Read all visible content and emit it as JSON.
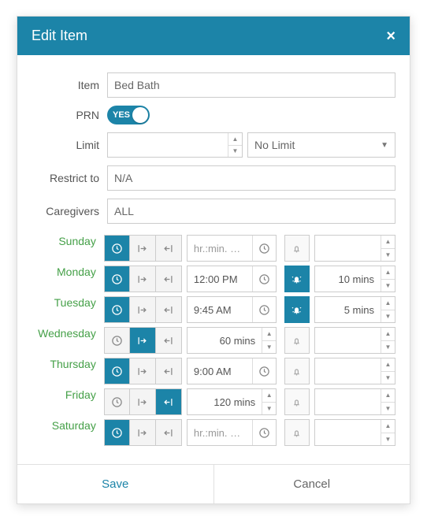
{
  "header": {
    "title": "Edit Item"
  },
  "labels": {
    "item": "Item",
    "prn": "PRN",
    "limit": "Limit",
    "restrict": "Restrict to",
    "caregivers": "Caregivers"
  },
  "fields": {
    "item": "Bed Bath",
    "prn_text": "YES",
    "limit_value": "",
    "limit_select": "No Limit",
    "restrict": "N/A",
    "caregivers": "ALL"
  },
  "time_placeholder": "hr.:min. …",
  "days": [
    {
      "name": "Sunday",
      "mode": "clock",
      "time": "",
      "time_type": "clock",
      "alert_on": false,
      "alert_value": ""
    },
    {
      "name": "Monday",
      "mode": "clock",
      "time": "12:00 PM",
      "time_type": "clock",
      "alert_on": true,
      "alert_value": "10 mins"
    },
    {
      "name": "Tuesday",
      "mode": "clock",
      "time": "9:45 AM",
      "time_type": "clock",
      "alert_on": true,
      "alert_value": "5 mins"
    },
    {
      "name": "Wednesday",
      "mode": "forward",
      "time": "60 mins",
      "time_type": "spinner",
      "alert_on": false,
      "alert_value": ""
    },
    {
      "name": "Thursday",
      "mode": "clock",
      "time": "9:00 AM",
      "time_type": "clock",
      "alert_on": false,
      "alert_value": ""
    },
    {
      "name": "Friday",
      "mode": "back",
      "time": "120 mins",
      "time_type": "spinner",
      "alert_on": false,
      "alert_value": ""
    },
    {
      "name": "Saturday",
      "mode": "clock",
      "time": "",
      "time_type": "clock",
      "alert_on": false,
      "alert_value": ""
    }
  ],
  "footer": {
    "save": "Save",
    "cancel": "Cancel"
  },
  "colors": {
    "brand": "#1c84a8"
  }
}
